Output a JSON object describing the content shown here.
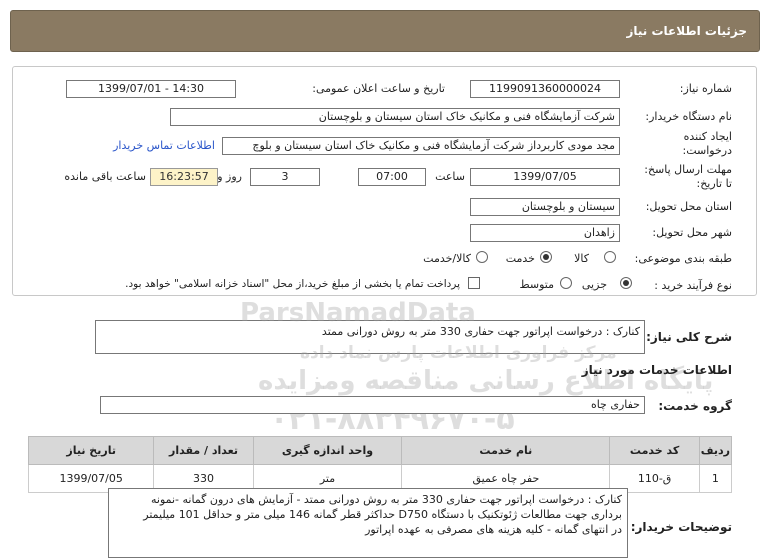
{
  "header": {
    "title": "جزئیات اطلاعات نیاز"
  },
  "form": {
    "need_number_label": "شماره نیاز:",
    "need_number": "1199091360000024",
    "announce_date_label": "تاریخ و ساعت اعلان عمومی:",
    "announce_date": "1399/07/01 - 14:30",
    "buyer_label": "نام دستگاه خریدار:",
    "buyer": "شرکت آزمایشگاه فنی و مکانیک خاک استان سیستان و بلوچستان",
    "creator_label_1": "ایجاد کننده",
    "creator_label_2": "درخواست:",
    "creator": "مجد مودی کاربرداز شرکت آزمایشگاه فنی و مکانیک خاک استان سیستان و بلوچ",
    "contact_link": "اطلاعات تماس خریدار",
    "deadline_label_1": "مهلت ارسال پاسخ:",
    "deadline_label_2": "تا تاریخ:",
    "deadline_date": "1399/07/05",
    "time_label": "ساعت",
    "deadline_time": "07:00",
    "days": "3",
    "days_label": "روز و",
    "remaining": "16:23:57",
    "remaining_label": "ساعت باقی مانده",
    "province_label": "استان محل تحویل:",
    "province": "سیستان و بلوچستان",
    "city_label": "شهر محل تحویل:",
    "city": "زاهدان",
    "category_label": "طبقه بندی موضوعی:",
    "category_options": [
      "کالا",
      "خدمت",
      "کالا/خدمت"
    ],
    "process_label": "نوع فرآیند خرید :",
    "process_options": [
      "جزیی",
      "متوسط"
    ],
    "payment_note": "پرداخت تمام یا بخشی از مبلغ خرید،از محل \"اسناد خزانه اسلامی\" خواهد بود."
  },
  "summary": {
    "label": "شرح کلی نیاز:",
    "text": "کنارک : درخواست اپراتور جهت حفاری 330 متر به روش دورانی ممتد"
  },
  "services": {
    "section_title": "اطلاعات خدمات مورد نیاز",
    "group_label": "گروه خدمت:",
    "group": "حفاری چاه",
    "columns": [
      "ردیف",
      "کد خدمت",
      "نام خدمت",
      "واحد اندازه گیری",
      "تعداد / مقدار",
      "تاریخ نیاز"
    ],
    "rows": [
      [
        "1",
        "ق-110",
        "حفر چاه عمیق",
        "متر",
        "330",
        "1399/07/05"
      ]
    ]
  },
  "buyer_notes": {
    "label": "توضیحات خریدار:",
    "line1": "کنارک : درخواست اپراتور جهت حفاری 330 متر به روش دورانی ممتد - آزمایش های درون گمانه -نمونه",
    "line2": "برداری جهت مطالعات ژئوتکنیک با دستگاه D750 حداکثر قطر گمانه 146 میلی متر و حداقل 101 میلیمتر",
    "line3": "در انتهای گمانه - کلیه هزینه های مصرفی به عهده اپراتور"
  },
  "watermark": {
    "brand": "ParsNamadData",
    "line1": "مرکز فراوری اطلاعات پارس نماد داده",
    "line2": "پایگاه اطلاع رسانی مناقصه ومزایده",
    "phone": "۰۲۱-۸۸۳۴۹۶۷۰-۵"
  }
}
